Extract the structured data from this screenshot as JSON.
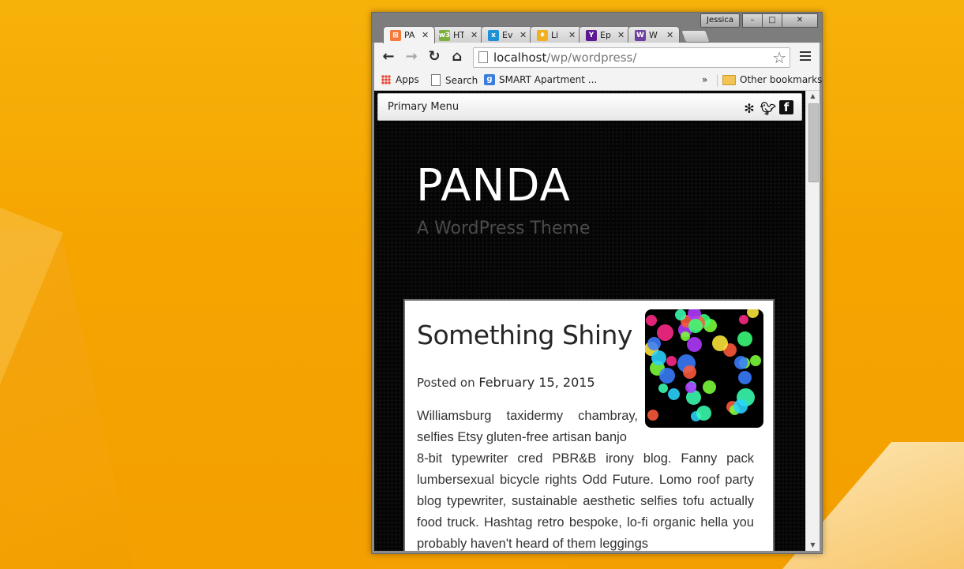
{
  "window": {
    "user_name": "Jessica",
    "controls": [
      "–",
      "□",
      "✕"
    ]
  },
  "tabs": [
    {
      "label": "PA",
      "favicon_color": "#f4793a",
      "favicon_glyph": "⊠",
      "active": true
    },
    {
      "label": "HT",
      "favicon_color": "#7bb13c",
      "favicon_glyph": "w3",
      "active": false
    },
    {
      "label": "Ev",
      "favicon_color": "#1e90d6",
      "favicon_glyph": "x",
      "active": false
    },
    {
      "label": "Li",
      "favicon_color": "#f2b01e",
      "favicon_glyph": "♦",
      "active": false
    },
    {
      "label": "Ep",
      "favicon_color": "#5b1a91",
      "favicon_glyph": "Y",
      "active": false
    },
    {
      "label": "W",
      "favicon_color": "#6c3fa0",
      "favicon_glyph": "W",
      "active": false
    }
  ],
  "toolbar": {
    "url_host": "localhost",
    "url_path": "/wp/wordpress/"
  },
  "bookmarks": {
    "items": [
      {
        "label": "Apps",
        "icon": "apps-grid-icon"
      },
      {
        "label": "Search",
        "icon": "page-icon"
      },
      {
        "label": "SMART Apartment ...",
        "icon": "google-icon"
      }
    ],
    "overflow": "»",
    "other": "Other bookmarks"
  },
  "page": {
    "menu_label": "Primary Menu",
    "social": [
      "yelp-icon",
      "twitter-icon",
      "facebook-icon"
    ],
    "site_title": "PANDA",
    "site_tagline": "A WordPress Theme",
    "post": {
      "title": "Something Shiny",
      "meta_prefix": "Posted on",
      "date": "February 15, 2015",
      "body_first": "Williamsburg taxidermy chambray, selfies Etsy gluten-free artisan banjo",
      "body_rest": "8-bit typewriter cred PBR&B irony blog. Fanny pack lumbersexual bicycle rights Odd Future. Lomo roof party blog typewriter, sustainable aesthetic selfies tofu actually food truck. Hashtag retro bespoke, lo-fi organic hella you probably haven't heard of them leggings"
    }
  }
}
